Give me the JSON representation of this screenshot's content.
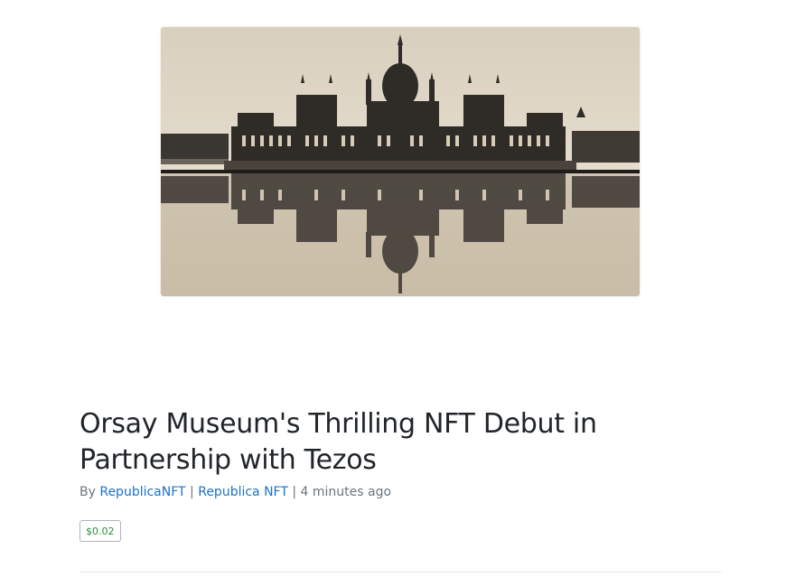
{
  "hero": {
    "image_desc": "sepia-toned photo of the Hungarian Parliament building reflected in still water"
  },
  "article": {
    "title": "Orsay Museum's Thrilling NFT Debut in Partnership with Tezos",
    "byline": {
      "prefix": "By",
      "author": "RepublicaNFT",
      "separator1": "|",
      "publication": "Republica NFT",
      "separator2": "|",
      "time": "4 minutes ago"
    },
    "price_badge": "$0.02"
  },
  "colors": {
    "title": "#212529",
    "link": "#1a73c8",
    "muted": "#6c757d",
    "price": "#2e8b3a"
  }
}
